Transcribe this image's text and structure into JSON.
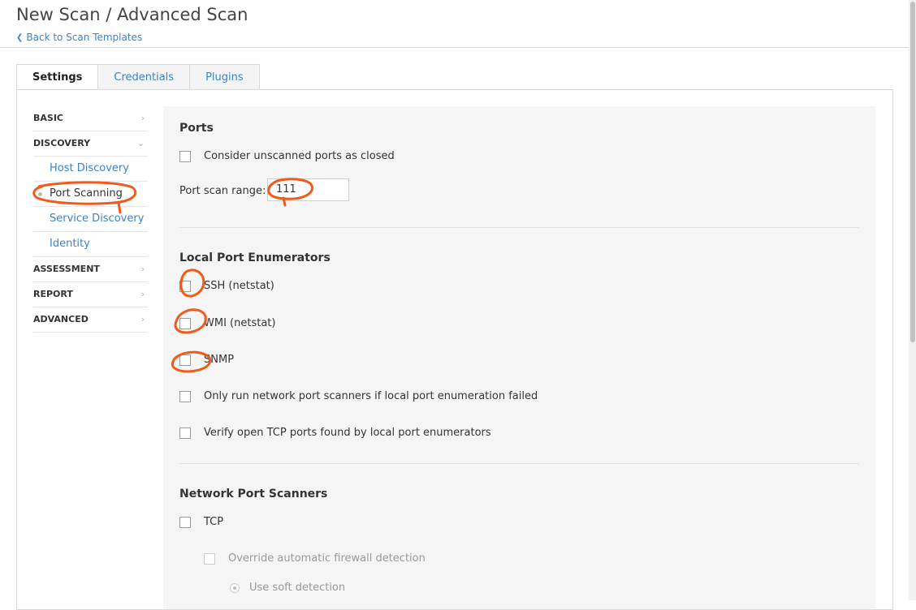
{
  "header": {
    "title": "New Scan / Advanced Scan",
    "back_label": "Back to Scan Templates"
  },
  "tabs": [
    {
      "label": "Settings",
      "active": true
    },
    {
      "label": "Credentials",
      "active": false
    },
    {
      "label": "Plugins",
      "active": false
    }
  ],
  "sidenav": {
    "basic": "BASIC",
    "discovery": "DISCOVERY",
    "discovery_items": [
      "Host Discovery",
      "Port Scanning",
      "Service Discovery",
      "Identity"
    ],
    "assessment": "ASSESSMENT",
    "report": "REPORT",
    "advanced": "ADVANCED"
  },
  "ports": {
    "title": "Ports",
    "consider_unscanned": "Consider unscanned ports as closed",
    "range_label": "Port scan range:",
    "range_value": "111"
  },
  "local_enum": {
    "title": "Local Port Enumerators",
    "ssh": "SSH (netstat)",
    "wmi": "WMI (netstat)",
    "snmp": "SNMP",
    "only_run": "Only run network port scanners if local port enumeration failed",
    "verify_tcp": "Verify open TCP ports found by local port enumerators"
  },
  "network_scanners": {
    "title": "Network Port Scanners",
    "tcp": "TCP",
    "override_firewall": "Override automatic firewall detection",
    "soft_detection": "Use soft detection"
  },
  "colors": {
    "link": "#3a83c8",
    "annotation": "#f05a1a",
    "content_bg": "#f5f5f5"
  }
}
